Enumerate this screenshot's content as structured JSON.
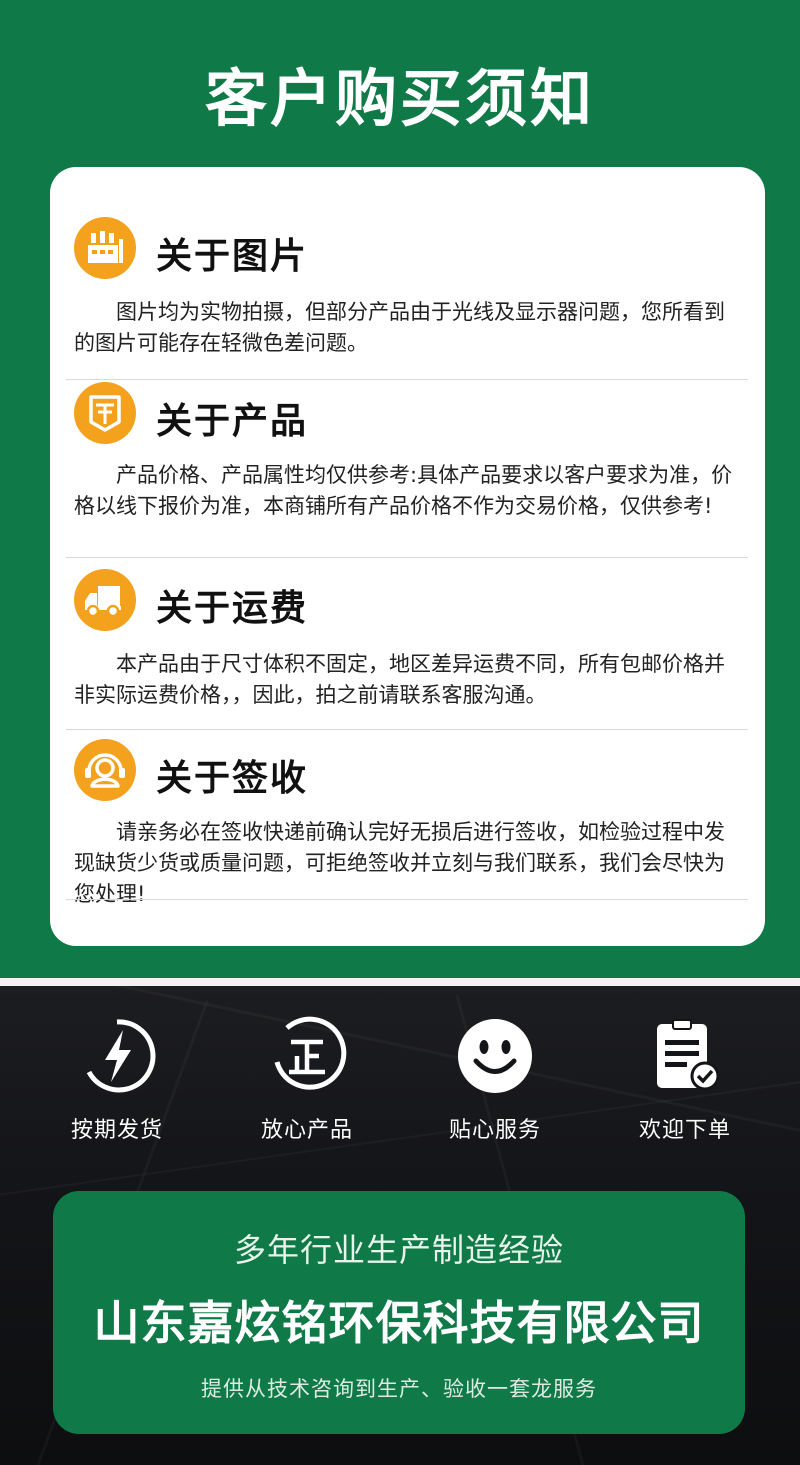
{
  "page": {
    "title": "客户购买须知"
  },
  "colors": {
    "brand_green": "#0f7a48",
    "accent_orange": "#f4a21d",
    "card_bg": "#ffffff",
    "dark_bg": "#141518"
  },
  "sections": [
    {
      "icon": "factory-icon",
      "title": "关于图片",
      "body": "图片均为实物拍摄，但部分产品由于光线及显示器问题，您所看到的图片可能存在轻微色差问题。"
    },
    {
      "icon": "shield-icon",
      "title": "关于产品",
      "body": "产品价格、产品属性均仅供参考:具体产品要求以客户要求为准，价格以线下报价为准，本商铺所有产品价格不作为交易价格，仅供参考!"
    },
    {
      "icon": "truck-icon",
      "title": "关于运费",
      "body": "本产品由于尺寸体积不固定，地区差异运费不同，所有包邮价格并非实际运费价格，，因此，拍之前请联系客服沟通。"
    },
    {
      "icon": "headset-icon",
      "title": "关于签收",
      "body": "请亲务必在签收快递前确认完好无损后进行签收，如检验过程中发现缺货少货或质量问题，可拒绝签收并立刻与我们联系，我们会尽快为您处理!"
    }
  ],
  "features": [
    {
      "icon": "lightning-icon",
      "label": "按期发货"
    },
    {
      "icon": "zheng-icon",
      "label": "放心产品"
    },
    {
      "icon": "smiley-icon",
      "label": "贴心服务"
    },
    {
      "icon": "order-document-icon",
      "label": "欢迎下单"
    }
  ],
  "company": {
    "tagline": "多年行业生产制造经验",
    "name": "山东嘉炫铭环保科技有限公司",
    "service": "提供从技术咨询到生产、验收一套龙服务"
  }
}
